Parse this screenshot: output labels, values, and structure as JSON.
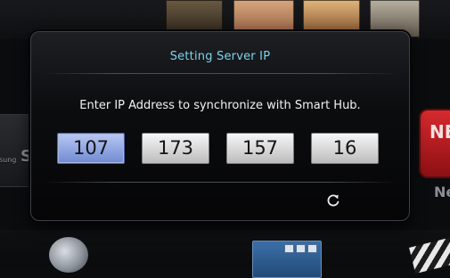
{
  "dialog": {
    "title": "Setting Server IP",
    "instruction": "Enter IP Address to synchronize with Smart Hub.",
    "ip_octets": [
      "107",
      "173",
      "157",
      "16"
    ],
    "active_octet": 0,
    "reset_icon": "refresh-icon"
  },
  "background": {
    "netflix_fragment": "NE",
    "netflix_label_fragment": "Ne",
    "samsung_apps_fragment": "St",
    "samsung_small_fragment": "sung"
  },
  "colors": {
    "title": "#7fd4ec",
    "active_field": "#90a6e2",
    "field": "#d7d7d7"
  }
}
